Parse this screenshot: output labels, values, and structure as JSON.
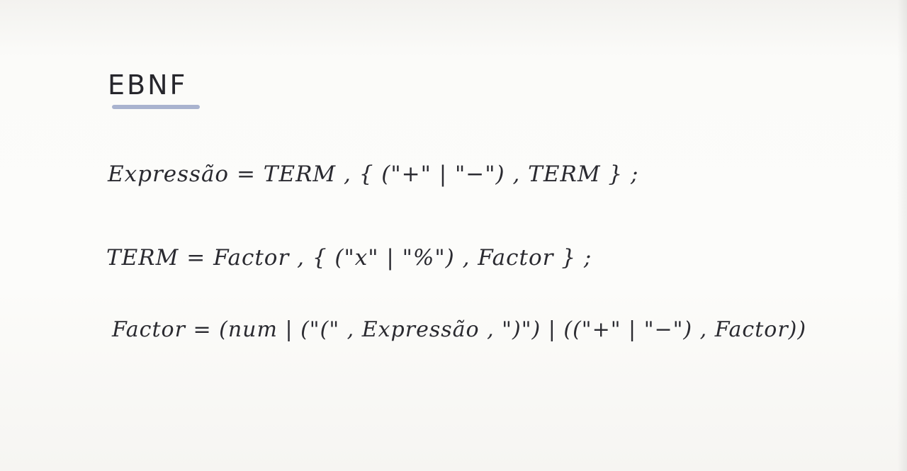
{
  "document": {
    "title": "EBNF",
    "rules": [
      {
        "text": "Expressão = TERM , { (\"+\" | \"−\") , TERM } ;"
      },
      {
        "text": "TERM = Factor , { (\"x\" | \"%\") , Factor } ;"
      },
      {
        "text": "Factor = (num | (\"(\" , Expressão , \")\") | ((\"+\" | \"−\") , Factor))"
      }
    ]
  },
  "colors": {
    "ink": "#2a2a30",
    "highlight": "#9aa6c8",
    "paper": "#fcfcfa"
  }
}
